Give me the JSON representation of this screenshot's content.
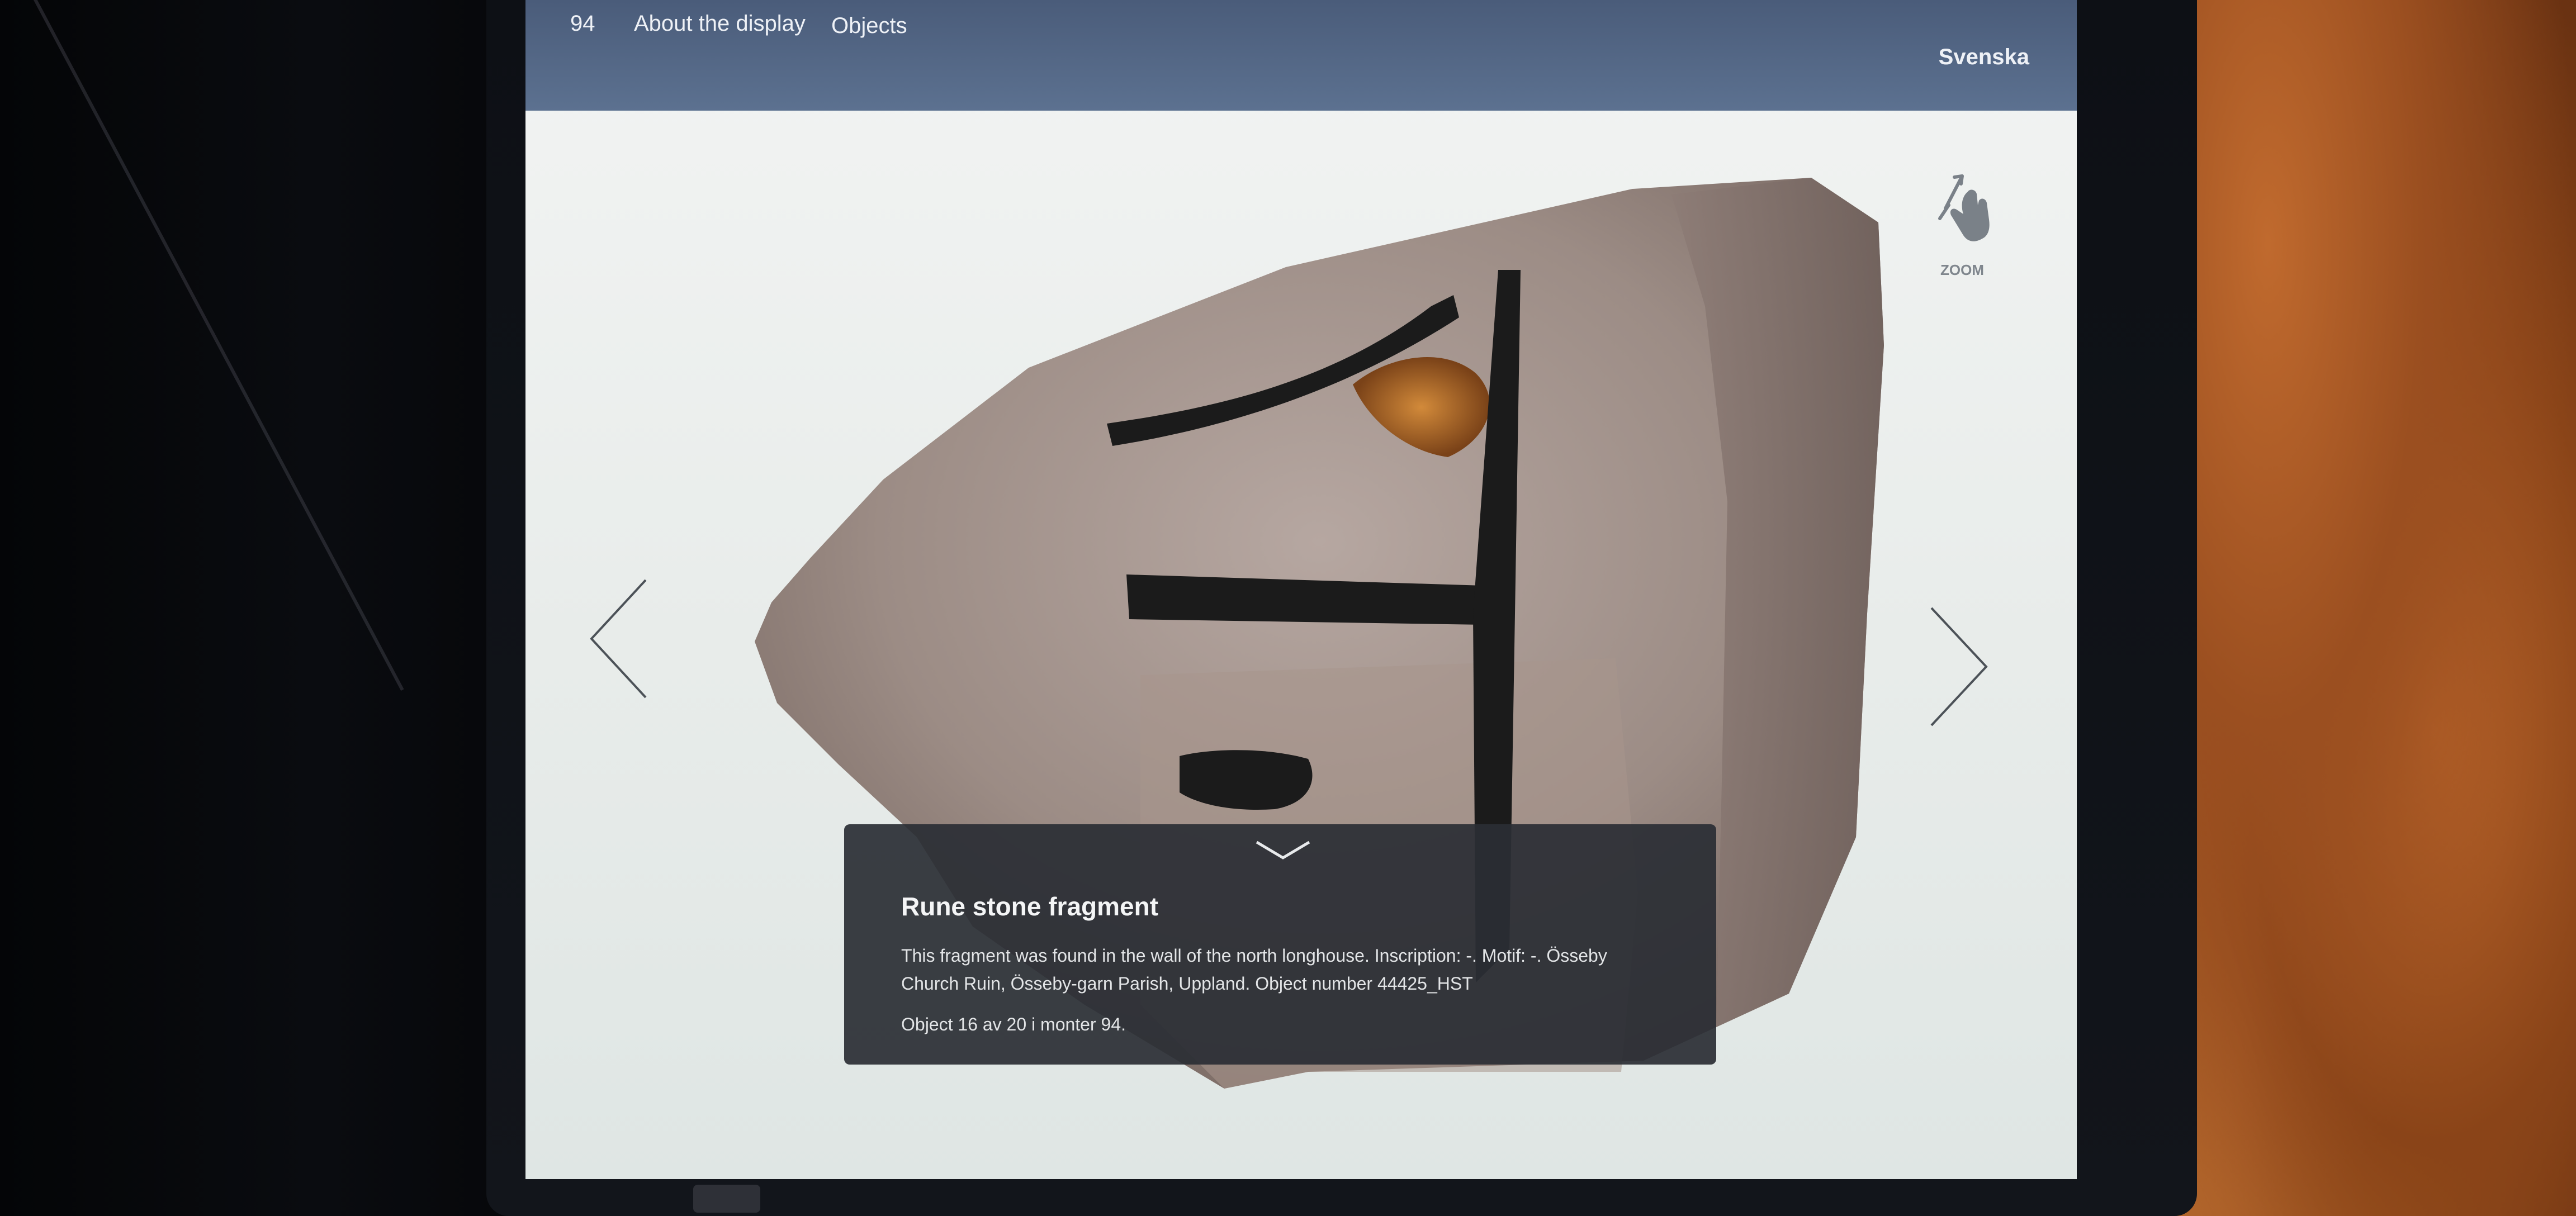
{
  "header": {
    "monter_number": "94",
    "nav": [
      "About the display",
      "Objects"
    ],
    "language": "Svenska"
  },
  "viewer": {
    "zoom_label": "ZOOM"
  },
  "object": {
    "title": "Rune stone fragment",
    "description": "This fragment was found in the wall of the north longhouse. Inscription: -. Motif: -. Össeby Church Ruin, Össeby-garn Parish, Uppland. Object number 44425_HST",
    "position": "Object 16 av 20 i monter 94."
  },
  "colors": {
    "header_bar": "#4f6281",
    "panel_bg": "#2a2e34",
    "screen_bg": "#eef0ef",
    "stone": "#9e8e87",
    "rune_paint": "#1a1a1a"
  }
}
